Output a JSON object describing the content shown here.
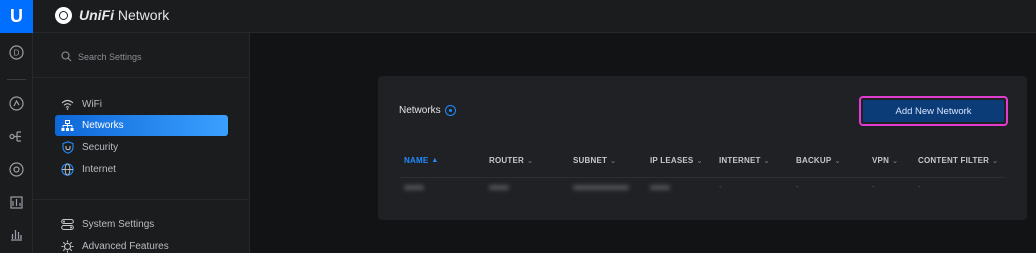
{
  "app": {
    "logo_letter": "U",
    "brand_bold": "UniFi",
    "brand_rest": " Network"
  },
  "rail": {
    "items": [
      {
        "icon": "dashboard-icon"
      },
      {
        "icon": "topology-icon"
      },
      {
        "icon": "devices-icon"
      },
      {
        "icon": "clients-icon"
      },
      {
        "icon": "insights-icon"
      },
      {
        "icon": "statistics-icon"
      }
    ]
  },
  "sidebar": {
    "search_placeholder": "Search Settings",
    "items": [
      {
        "label": "WiFi",
        "icon": "wifi-icon",
        "active": false
      },
      {
        "label": "Networks",
        "icon": "networks-icon",
        "active": true
      },
      {
        "label": "Security",
        "icon": "shield-icon",
        "active": false
      },
      {
        "label": "Internet",
        "icon": "globe-icon",
        "active": false
      },
      {
        "label": "System Settings",
        "icon": "system-settings-icon",
        "active": false
      },
      {
        "label": "Advanced Features",
        "icon": "advanced-features-icon",
        "active": false
      }
    ]
  },
  "panel": {
    "title": "Networks",
    "add_button": "Add New Network",
    "columns": [
      "NAME",
      "ROUTER",
      "SUBNET",
      "IP LEASES",
      "INTERNET",
      "BACKUP",
      "VPN",
      "CONTENT FILTER"
    ],
    "sorted_column": "NAME",
    "row": [
      "-",
      "-",
      "-",
      "-"
    ]
  },
  "colors": {
    "accent": "#1f8cff",
    "highlight_outline": "#e13ccf",
    "button_fill": "#0c3c78"
  }
}
